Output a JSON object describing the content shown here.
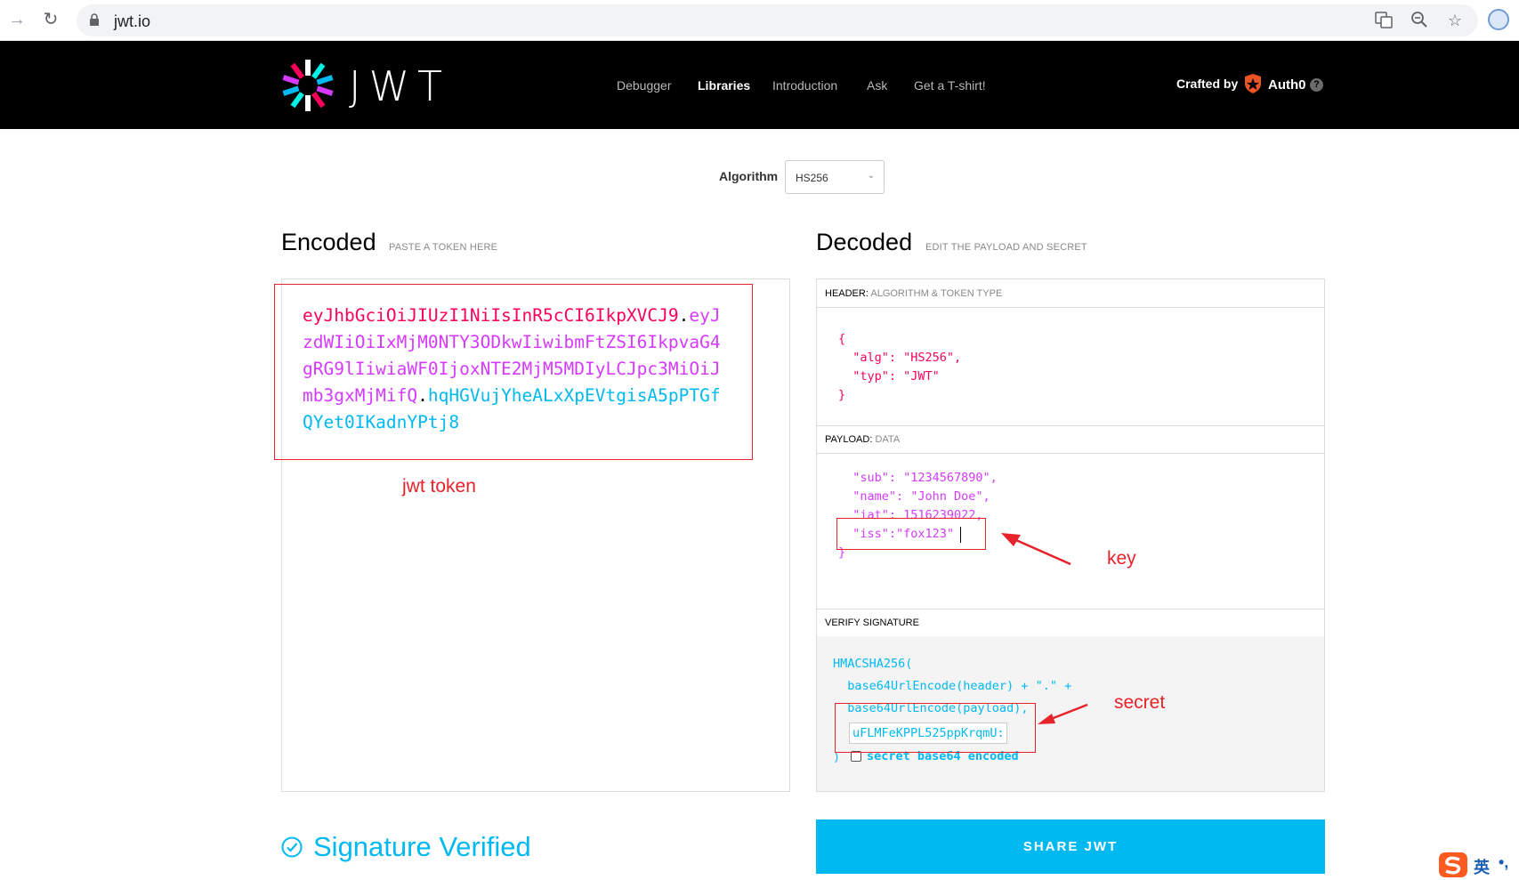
{
  "browser": {
    "url": "jwt.io"
  },
  "header": {
    "logo_text": "JWT",
    "nav": [
      "Debugger",
      "Libraries",
      "Introduction",
      "Ask",
      "Get a T-shirt!"
    ],
    "active_nav": "Libraries",
    "crafted_by": "Crafted by",
    "brand": "Auth0",
    "help": "?"
  },
  "algorithm": {
    "label": "Algorithm",
    "value": "HS256"
  },
  "encoded": {
    "title": "Encoded",
    "subtitle": "PASTE A TOKEN HERE",
    "token_header": "eyJhbGciOiJIUzI1NiIsInR5cCI6IkpXVCJ9",
    "token_payload": "eyJzdWIiOiIxMjM0NTY3ODkwIiwibmFtZSI6IkpvaG4gRG9lIiwiaWF0IjoxNTE2MjM5MDIyLCJpc3MiOiJmb3gxMjMifQ",
    "token_signature": "hqHGVujYheALxXpEVtgisA5pPTGfQYet0IKadnYPtj8",
    "dot": "."
  },
  "decoded": {
    "title": "Decoded",
    "subtitle": "EDIT THE PAYLOAD AND SECRET",
    "header_label": "HEADER:",
    "header_sub": "ALGORITHM & TOKEN TYPE",
    "header_json": "{\n  \"alg\": \"HS256\",\n  \"typ\": \"JWT\"\n}",
    "payload_label": "PAYLOAD:",
    "payload_sub": "DATA",
    "payload_lines": [
      "  \"sub\": \"1234567890\",",
      "  \"name\": \"John Doe\",",
      "  \"iat\": 1516239022,",
      "  \"iss\":\"fox123\"",
      "}"
    ],
    "verify_label": "VERIFY SIGNATURE",
    "sig_line1": "HMACSHA256(",
    "sig_line2": "  base64UrlEncode(header) + \".\" +",
    "sig_line3": "  base64UrlEncode(payload),",
    "secret_value": "uFLMFeKPPL525ppKrqmU:",
    "sig_close": ")",
    "checkbox_label": "secret base64 encoded"
  },
  "footer": {
    "verified": "Signature Verified",
    "share": "SHARE JWT"
  },
  "annotations": {
    "token_label": "jwt token",
    "key_label": "key",
    "secret_label": "secret",
    "color": "#e8222a"
  },
  "ime": {
    "lang": "英"
  },
  "colors": {
    "header_red": "#fb015b",
    "payload_purple": "#d63aff",
    "signature_blue": "#00b9f1"
  }
}
